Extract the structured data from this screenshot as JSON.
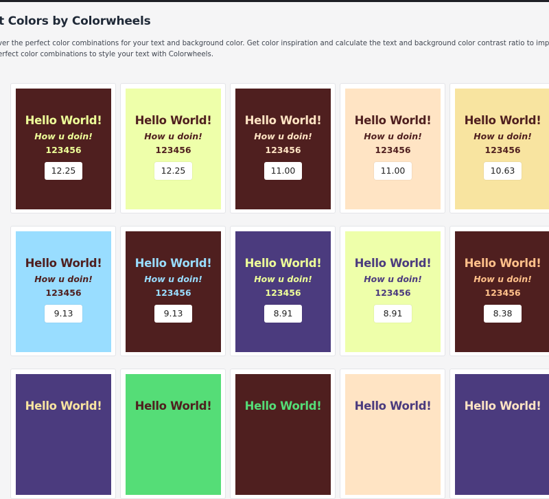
{
  "page": {
    "title": "t Colors by Colorwheels",
    "description_line1": "ver the perfect color combinations for your text and background color. Get color inspiration and calculate the text and background color contrast ratio to improve th",
    "description_line2": "erfect color combinations to style your text with Colorwheels."
  },
  "colors": {
    "page_bg": "#f5f5f6",
    "top_bar": "#1f2026"
  },
  "cards": [
    {
      "bg": "#4f1f1f",
      "fg": "#eeff99",
      "hello": "Hello World!",
      "how": "How u doin!",
      "nums": "123456",
      "ratio": "12.25"
    },
    {
      "bg": "#eeffaa",
      "fg": "#4f1f1f",
      "hello": "Hello World!",
      "how": "How u doin!",
      "nums": "123456",
      "ratio": "12.25"
    },
    {
      "bg": "#4f1f1f",
      "fg": "#ffe4c4",
      "hello": "Hello World!",
      "how": "How u doin!",
      "nums": "123456",
      "ratio": "11.00"
    },
    {
      "bg": "#ffe4c4",
      "fg": "#4f1f1f",
      "hello": "Hello World!",
      "how": "How u doin!",
      "nums": "123456",
      "ratio": "11.00"
    },
    {
      "bg": "#f8e4a0",
      "fg": "#4f1f1f",
      "hello": "Hello World!",
      "how": "How u doin!",
      "nums": "123456",
      "ratio": "10.63"
    },
    {
      "bg": "#99ddff",
      "fg": "#4f1f1f",
      "hello": "Hello World!",
      "how": "How u doin!",
      "nums": "123456",
      "ratio": "9.13"
    },
    {
      "bg": "#4f1f1f",
      "fg": "#99ddff",
      "hello": "Hello World!",
      "how": "How u doin!",
      "nums": "123456",
      "ratio": "9.13"
    },
    {
      "bg": "#4b3b7e",
      "fg": "#eeff99",
      "hello": "Hello World!",
      "how": "How u doin!",
      "nums": "123456",
      "ratio": "8.91"
    },
    {
      "bg": "#eeffaa",
      "fg": "#4b3b7e",
      "hello": "Hello World!",
      "how": "How u doin!",
      "nums": "123456",
      "ratio": "8.91"
    },
    {
      "bg": "#4f1f1f",
      "fg": "#ffc08a",
      "hello": "Hello World!",
      "how": "How u doin!",
      "nums": "123456",
      "ratio": "8.38"
    },
    {
      "bg": "#4b3b7e",
      "fg": "#f8e4a0",
      "hello": "Hello World!",
      "how": "",
      "nums": "",
      "ratio": ""
    },
    {
      "bg": "#55dd77",
      "fg": "#4f1f1f",
      "hello": "Hello World!",
      "how": "",
      "nums": "",
      "ratio": ""
    },
    {
      "bg": "#4f1f1f",
      "fg": "#55dd77",
      "hello": "Hello World!",
      "how": "",
      "nums": "",
      "ratio": ""
    },
    {
      "bg": "#ffe4c4",
      "fg": "#4b3b7e",
      "hello": "Hello World!",
      "how": "",
      "nums": "",
      "ratio": ""
    },
    {
      "bg": "#4b3b7e",
      "fg": "#ffe4c4",
      "hello": "Hello World!",
      "how": "",
      "nums": "",
      "ratio": ""
    }
  ]
}
